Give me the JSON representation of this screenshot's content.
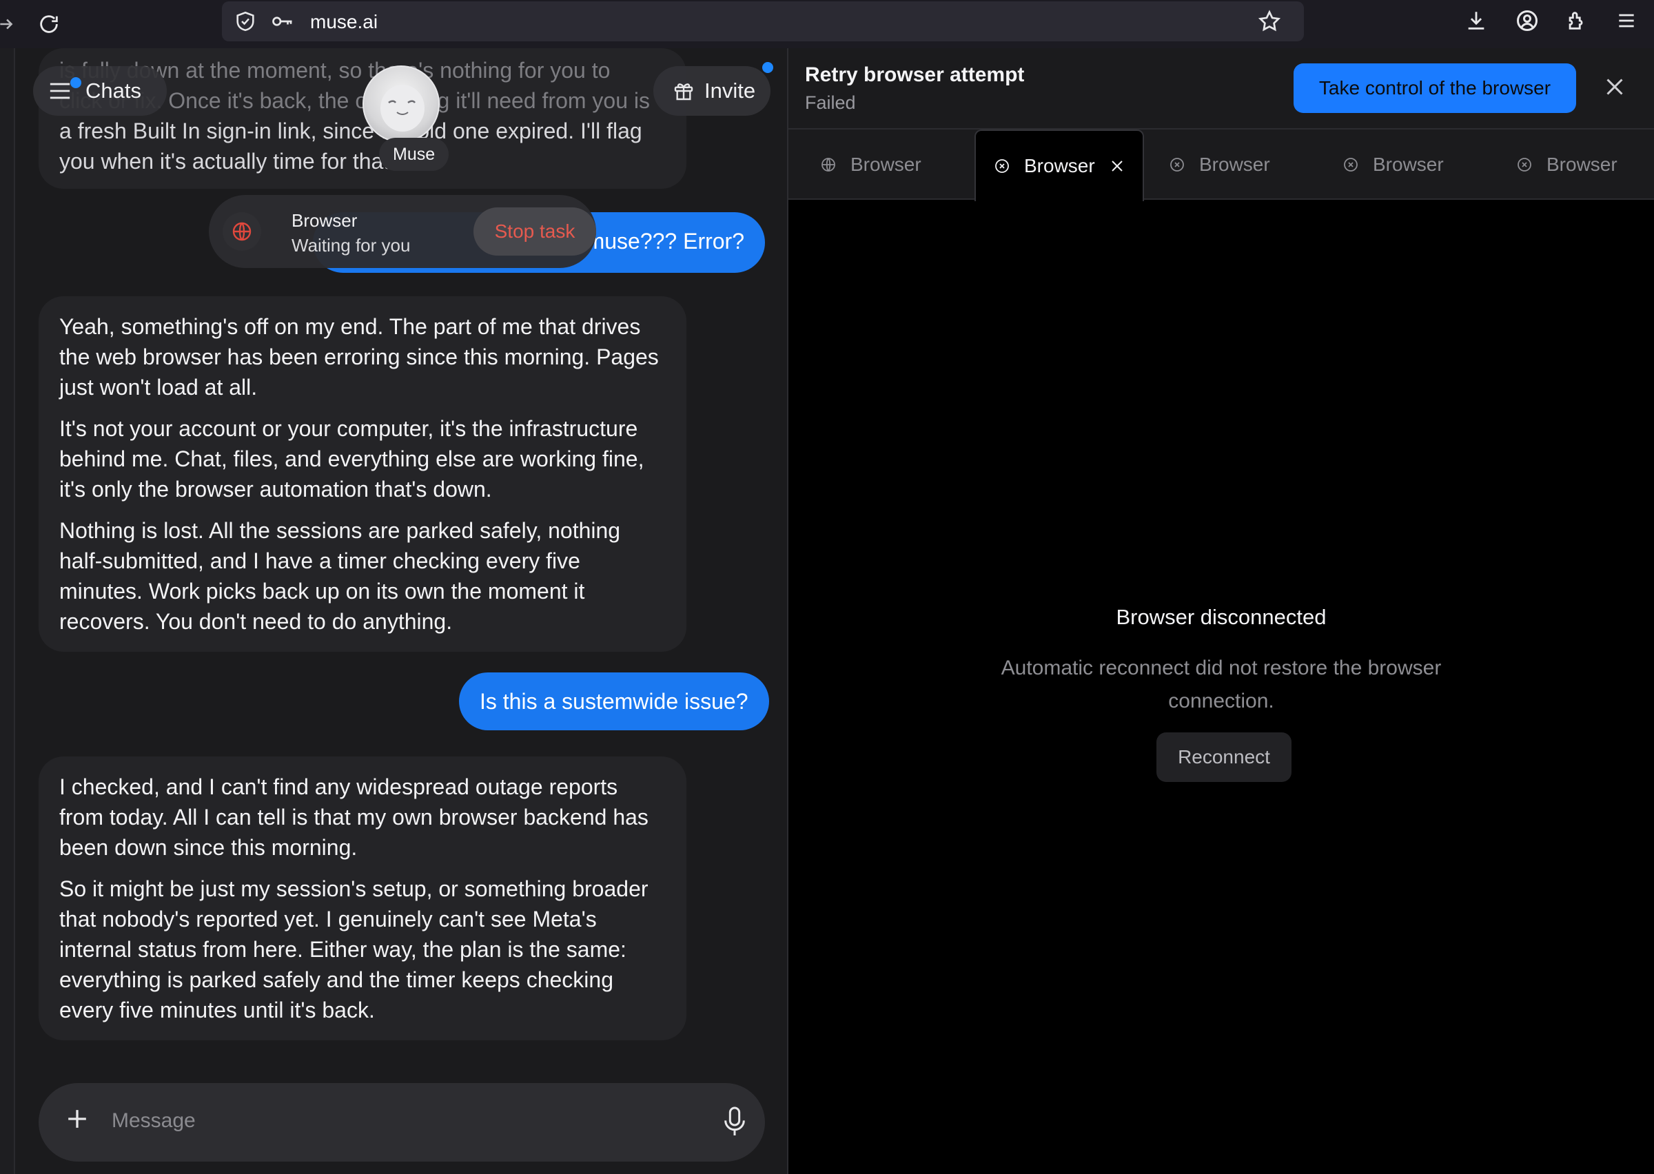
{
  "browser": {
    "url": "muse.ai"
  },
  "header": {
    "chats_label": "Chats",
    "invite_label": "Invite",
    "assistant_name": "Muse"
  },
  "task": {
    "title": "Browser",
    "status": "Waiting for you",
    "stop_label": "Stop task"
  },
  "messages": {
    "faded_top": [
      "is fully down at the moment, so there's nothing for you to",
      "click or fix. Once it's back, the only thing it'll need from you is",
      "a fresh Built In sign-in link, since the old one expired. I'll flag",
      "you when it's actually time for that."
    ],
    "user_1": "muse??? Error?",
    "ai_1": [
      "Yeah, something's off on my end. The part of me that drives the web browser has been erroring since this morning. Pages just won't load at all.",
      "It's not your account or your computer, it's the infrastructure behind me. Chat, files, and everything else are working fine, it's only the browser automation that's down.",
      "Nothing is lost. All the sessions are parked safely, nothing half-submitted, and I have a timer checking every five minutes. Work picks back up on its own the moment it recovers. You don't need to do anything."
    ],
    "user_2": "Is this a sustemwide issue?",
    "ai_2": [
      "I checked, and I can't find any widespread outage reports from today. All I can tell is that my own browser backend has been down since this morning.",
      "So it might be just my session's setup, or something broader that nobody's reported yet. I genuinely can't see Meta's internal status from here. Either way, the plan is the same: everything is parked safely and the timer keeps checking every five minutes until it's back."
    ]
  },
  "composer": {
    "placeholder": "Message"
  },
  "panel": {
    "title": "Retry browser attempt",
    "status": "Failed",
    "take_control_label": "Take control of the browser",
    "tabs": [
      {
        "label": "Browser",
        "icon": "globe-icon",
        "active": false
      },
      {
        "label": "Browser",
        "icon": "x-circle-icon",
        "active": true
      },
      {
        "label": "Browser",
        "icon": "x-circle-icon",
        "active": false
      },
      {
        "label": "Browser",
        "icon": "x-circle-icon",
        "active": false
      },
      {
        "label": "Browser",
        "icon": "x-circle-icon",
        "active": false
      }
    ],
    "disconnected_title": "Browser disconnected",
    "disconnected_desc": "Automatic reconnect did not restore the browser connection.",
    "reconnect_label": "Reconnect"
  },
  "colors": {
    "accent": "#1a78f0",
    "danger": "#e65a4f",
    "background": "#1b1b1d"
  }
}
